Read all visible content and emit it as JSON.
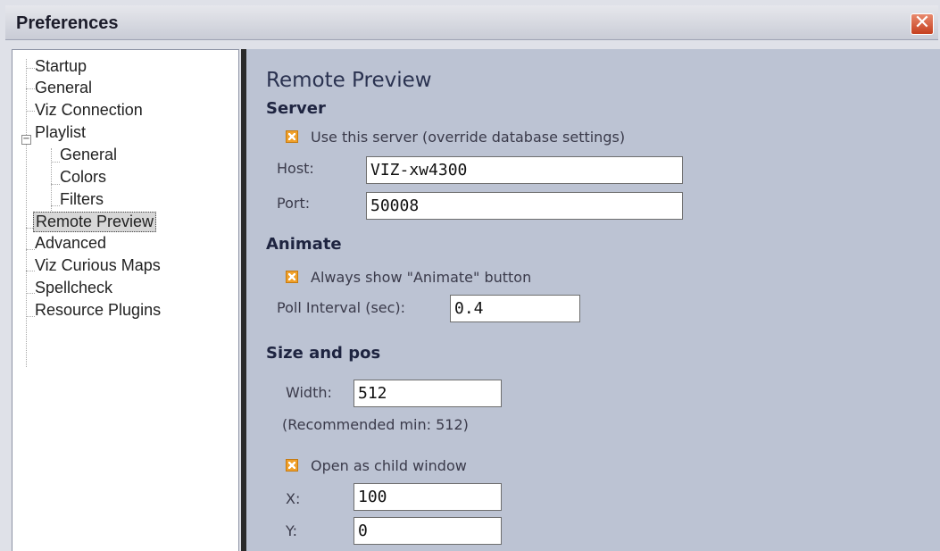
{
  "window": {
    "title": "Preferences",
    "close_glyph": "✕"
  },
  "tree": {
    "items": [
      {
        "label": "Startup",
        "level": 0
      },
      {
        "label": "General",
        "level": 0
      },
      {
        "label": "Viz Connection",
        "level": 0
      },
      {
        "label": "Playlist",
        "level": 0,
        "expanded": true
      },
      {
        "label": "General",
        "level": 1
      },
      {
        "label": "Colors",
        "level": 1
      },
      {
        "label": "Filters",
        "level": 1
      },
      {
        "label": "Remote Preview",
        "level": 0,
        "selected": true
      },
      {
        "label": "Advanced",
        "level": 0
      },
      {
        "label": "Viz Curious Maps",
        "level": 0
      },
      {
        "label": "Spellcheck",
        "level": 0
      },
      {
        "label": "Resource Plugins",
        "level": 0
      }
    ],
    "expander_glyph": "−"
  },
  "panel": {
    "title": "Remote Preview",
    "server": {
      "heading": "Server",
      "use_server_label": "Use this server (override database settings)",
      "use_server_checked": true,
      "host_label": "Host:",
      "host_value": "VIZ-xw4300",
      "port_label": "Port:",
      "port_value": "50008"
    },
    "animate": {
      "heading": "Animate",
      "always_show_label": "Always show \"Animate\" button",
      "always_show_checked": true,
      "poll_label": "Poll Interval (sec):",
      "poll_value": "0.4"
    },
    "size_pos": {
      "heading": "Size and pos",
      "width_label": "Width:",
      "width_value": "512",
      "recommended": "(Recommended min: 512)",
      "child_window_label": "Open as child window",
      "child_window_checked": true,
      "x_label": "X:",
      "x_value": "100",
      "y_label": "Y:",
      "y_value": "0"
    }
  },
  "colors": {
    "accent_checkbox": "#f0a02a",
    "panel_bg": "#bcc3d3",
    "close_button": "#d4502d"
  }
}
